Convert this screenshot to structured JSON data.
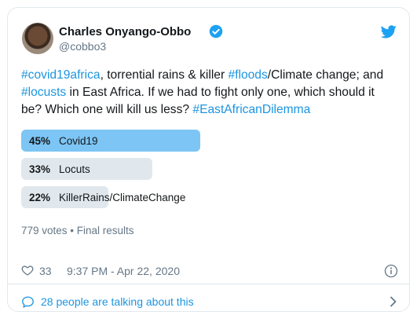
{
  "author": {
    "name": "Charles Onyango-Obbo",
    "handle": "@cobbo3"
  },
  "icons": {
    "avatar": "profile-photo",
    "verified": "verified-badge-icon",
    "brand": "twitter-bird-icon",
    "like": "heart-icon",
    "info": "info-icon",
    "talking": "chat-bubble-icon",
    "chevron": "chevron-right-icon"
  },
  "tweet": {
    "segments": [
      {
        "text": "#covid19africa",
        "tag": true
      },
      {
        "text": ", torrential rains & killer ",
        "tag": false
      },
      {
        "text": "#floods",
        "tag": true
      },
      {
        "text": "/Climate change; and ",
        "tag": false
      },
      {
        "text": "#locusts",
        "tag": true
      },
      {
        "text": " in East Africa. If we had to fight only one, which should it be? Which one will kill us less? ",
        "tag": false
      },
      {
        "text": "#EastAfricanDilemma",
        "tag": true
      }
    ]
  },
  "poll": {
    "options": [
      {
        "percent_label": "45%",
        "label": "Covid19",
        "percent": 45,
        "winner": true
      },
      {
        "percent_label": "33%",
        "label": "Locuts",
        "percent": 33,
        "winner": false
      },
      {
        "percent_label": "22%",
        "label": "KillerRains/ClimateChange",
        "percent": 22,
        "winner": false
      }
    ],
    "meta": "779 votes • Final results"
  },
  "footer": {
    "like_count": "33",
    "timestamp": "9:37 PM - Apr 22, 2020"
  },
  "talking": {
    "label": "28 people are talking about this"
  },
  "colors": {
    "accent": "#1b95e0",
    "winner_bar": "#7cc5f4",
    "bar": "#e1e8ed",
    "muted_text": "#657786"
  }
}
